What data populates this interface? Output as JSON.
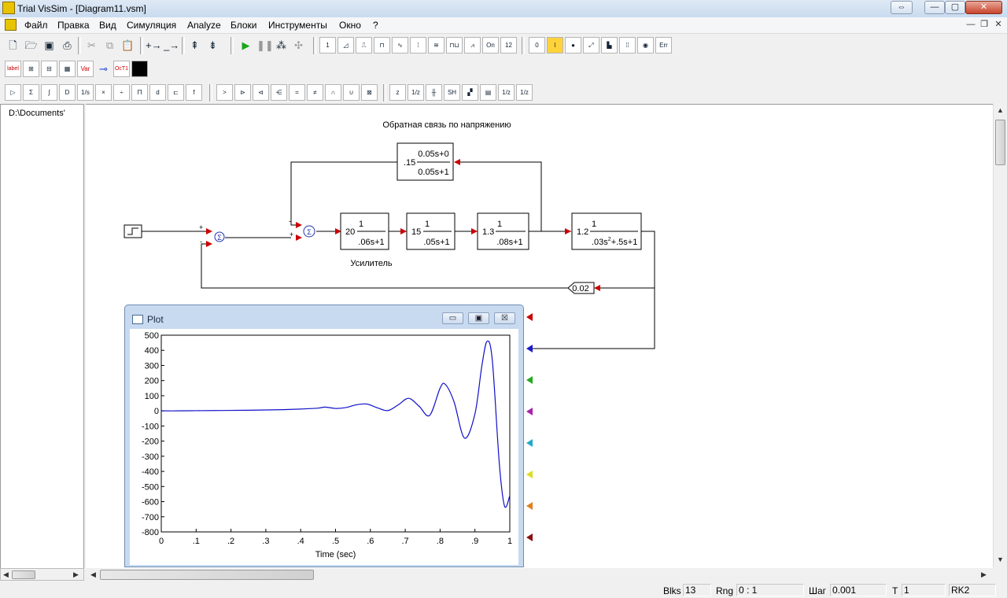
{
  "window": {
    "title": "Trial VisSim - [Diagram11.vsm]",
    "btn_restore": "⇔",
    "btn_min": "—",
    "btn_max": "▢",
    "btn_close": "✕"
  },
  "menu": {
    "items": [
      "Файл",
      "Правка",
      "Вид",
      "Симуляция",
      "Analyze",
      "Блоки",
      "Инструменты",
      "Окно",
      "?"
    ],
    "mdi_min": "—",
    "mdi_restore": "❐",
    "mdi_close": "✕"
  },
  "toolbar1": {
    "file_icons": [
      "new-icon",
      "open-icon",
      "save-icon",
      "print-icon"
    ],
    "edit_icons": [
      "cut-icon",
      "copy-icon",
      "paste-icon"
    ]
  },
  "toolbar2": {
    "labels": [
      "label",
      "Var",
      "OcT1"
    ]
  },
  "tree": {
    "root": "D:\\Documents'"
  },
  "diagram": {
    "caption_top": "Обратная связь по напряжению",
    "caption_amp": "Усилитель",
    "feedback_block": {
      "gain": ".15",
      "num": "0.05s+0",
      "den": "0.05s+1"
    },
    "blocks": [
      {
        "gain": "20",
        "num": "1",
        "den": ".06s+1"
      },
      {
        "gain": "15",
        "num": "1",
        "den": ".05s+1"
      },
      {
        "gain": "1.3",
        "num": "1",
        "den": ".08s+1"
      },
      {
        "gain": "1.2",
        "num": "1",
        "den_a": ".03s",
        "den_exp": "2",
        "den_b": "+.5s+1"
      }
    ],
    "gain_block": "0.02",
    "sum_signs": {
      "s1_plus": "+",
      "s1_minus": "-",
      "s2_top": "-",
      "s2_plus": "+"
    }
  },
  "plot": {
    "title": "Plot",
    "btn_min": "▭",
    "btn_max": "▣",
    "btn_close": "☒",
    "input_colors": [
      "#cc0000",
      "#1a1acc",
      "#22aa22",
      "#aa22aa",
      "#22aacc",
      "#dddd22",
      "#e08020",
      "#881010"
    ]
  },
  "chart_data": {
    "type": "line",
    "title": "",
    "xlabel": "Time (sec)",
    "ylabel": "",
    "xlim": [
      0,
      1
    ],
    "ylim": [
      -800,
      500
    ],
    "x_ticks": [
      "0",
      ".1",
      ".2",
      ".3",
      ".4",
      ".5",
      ".6",
      ".7",
      ".8",
      ".9",
      "1"
    ],
    "y_ticks": [
      "500",
      "400",
      "300",
      "200",
      "100",
      "0",
      "-100",
      "-200",
      "-300",
      "-400",
      "-500",
      "-600",
      "-700",
      "-800"
    ],
    "series": [
      {
        "color": "#1010c8",
        "x": [
          0,
          0.05,
          0.1,
          0.15,
          0.2,
          0.25,
          0.3,
          0.35,
          0.4,
          0.45,
          0.47,
          0.5,
          0.53,
          0.56,
          0.59,
          0.62,
          0.65,
          0.68,
          0.71,
          0.74,
          0.77,
          0.8,
          0.815,
          0.84,
          0.87,
          0.9,
          0.92,
          0.935,
          0.95,
          0.97,
          0.985,
          1.0
        ],
        "y": [
          0,
          0,
          1,
          2,
          3,
          4,
          6,
          8,
          12,
          18,
          25,
          16,
          22,
          40,
          45,
          20,
          2,
          40,
          83,
          30,
          -30,
          150,
          175,
          60,
          -180,
          -20,
          300,
          460,
          330,
          -350,
          -630,
          -560
        ]
      }
    ]
  },
  "status": {
    "blks_label": "Blks",
    "blks_value": "13",
    "rng_label": "Rng",
    "rng_value": "0 : 1",
    "step_label": "Шаг",
    "step_value": "0.001",
    "t_label": "T",
    "t_value": "1",
    "method": "RK2"
  }
}
